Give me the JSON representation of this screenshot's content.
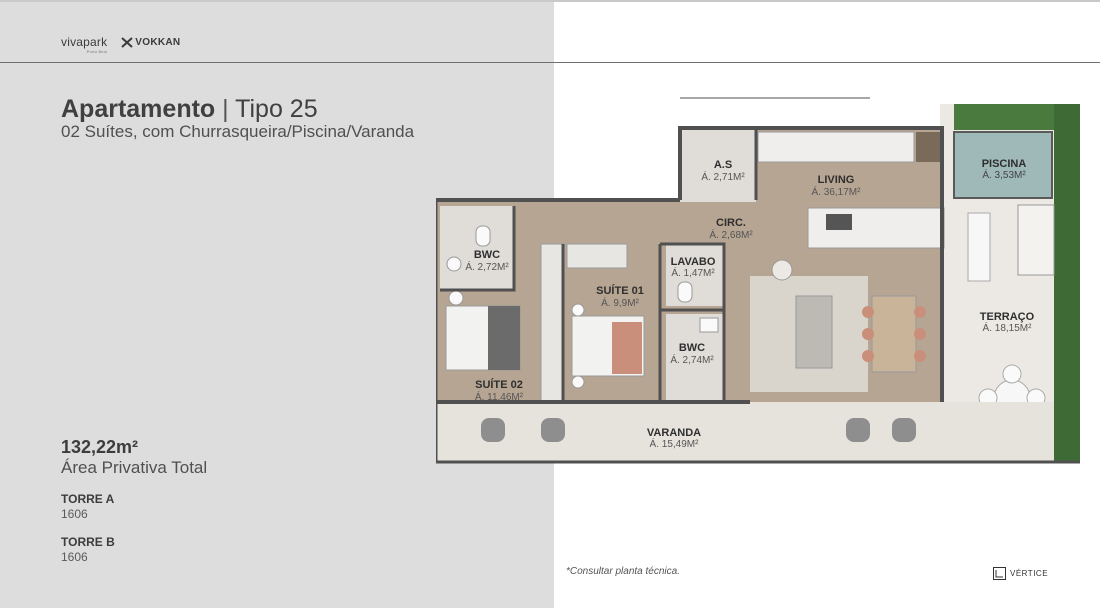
{
  "header": {
    "logo_primary": "vivapark",
    "logo_primary_sub": "Porto Belo",
    "logo_secondary": "VOKKAN",
    "logo_secondary_icon": "x-mark-icon"
  },
  "unit": {
    "title_bold": "Apartamento",
    "title_separator": "|",
    "title_type": "Tipo 25",
    "subtitle": "02 Suítes, com Churrasqueira/Piscina/Varanda",
    "area_value": "132,22m²",
    "area_label": "Área Privativa Total",
    "towers": [
      {
        "label": "TORRE A",
        "unit": "1606"
      },
      {
        "label": "TORRE B",
        "unit": "1606"
      }
    ]
  },
  "floorplan": {
    "rooms": [
      {
        "name": "A.S",
        "area": "Á. 2,71M²"
      },
      {
        "name": "LIVING",
        "area": "Á. 36,17M²"
      },
      {
        "name": "PISCINA",
        "area": "Á. 3,53M²"
      },
      {
        "name": "CIRC.",
        "area": "Á. 2,68M²"
      },
      {
        "name": "BWC",
        "area": "Á. 2,72M²"
      },
      {
        "name": "LAVABO",
        "area": "Á. 1,47M²"
      },
      {
        "name": "SUÍTE 01",
        "area": "Á. 9,9M²"
      },
      {
        "name": "TERRAÇO",
        "area": "Á. 18,15M²"
      },
      {
        "name": "BWC",
        "area": "Á. 2,74M²"
      },
      {
        "name": "SUÍTE 02",
        "area": "Á. 11,46M²"
      },
      {
        "name": "VARANDA",
        "area": "Á. 15,49M²"
      }
    ],
    "colors": {
      "wood": "#b7a593",
      "tile": "#e6e3dd",
      "wall": "#505050",
      "pool": "#9fb8b8",
      "plants": "#3e6b35"
    }
  },
  "footer": {
    "note": "*Consultar planta técnica.",
    "brand": "VÉRTICE",
    "brand_icon": "vertice-logo-icon"
  }
}
